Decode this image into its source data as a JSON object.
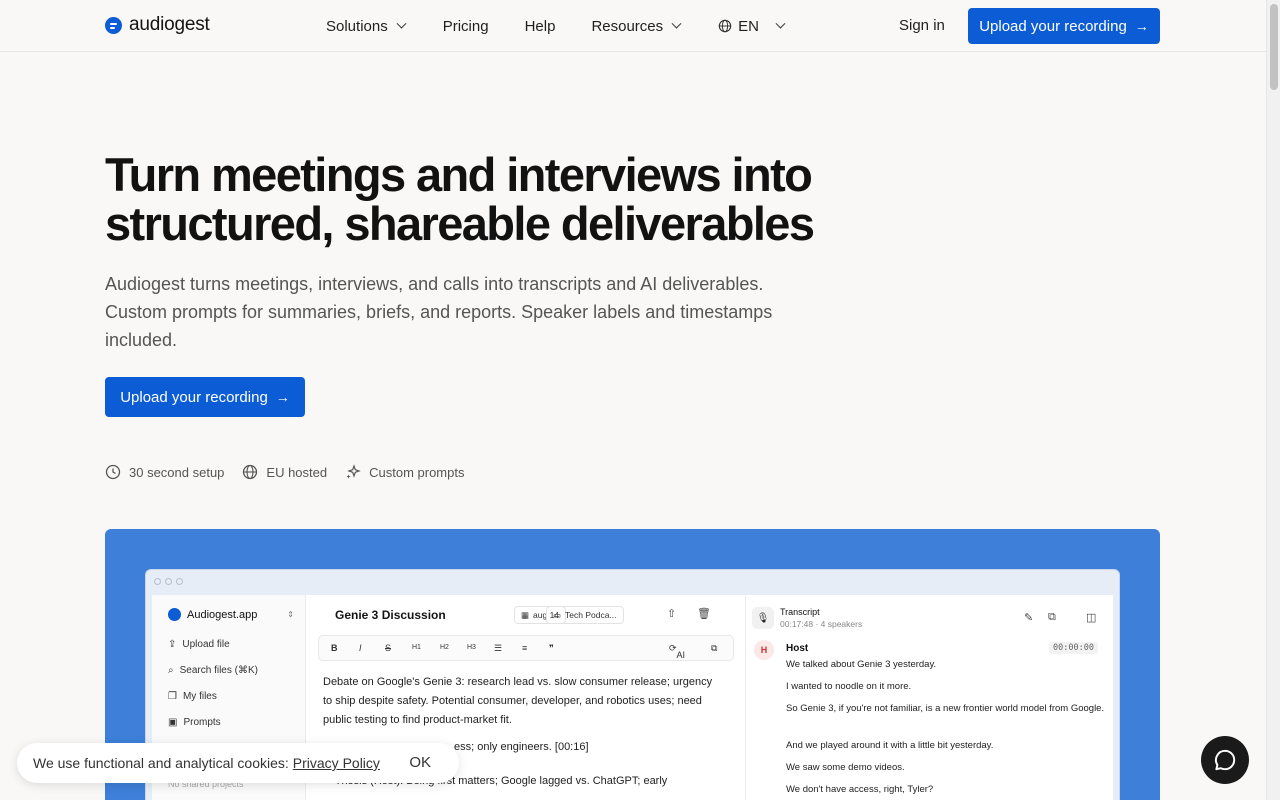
{
  "brand": {
    "name": "audiogest",
    "color": "#0b5cd5"
  },
  "nav": {
    "items": [
      {
        "label": "Solutions",
        "dropdown": true
      },
      {
        "label": "Pricing",
        "dropdown": false
      },
      {
        "label": "Help",
        "dropdown": false
      },
      {
        "label": "Resources",
        "dropdown": true
      }
    ],
    "language": "EN",
    "sign_in": "Sign in",
    "cta": "Upload your recording"
  },
  "hero": {
    "title_line1": "Turn meetings and interviews into",
    "title_line2": "structured, shareable deliverables",
    "subtitle": "Audiogest turns meetings, interviews, and calls into transcripts and AI deliverables. Custom prompts for summaries, briefs, and reports. Speaker labels and timestamps included.",
    "cta": "Upload your recording",
    "features": [
      "30 second setup",
      "EU hosted",
      "Custom prompts"
    ]
  },
  "preview": {
    "sidebar": {
      "workspace": "Audiogest.app",
      "items": [
        "Upload file",
        "Search files (⌘K)",
        "My files",
        "Prompts"
      ],
      "muted": "No shared projects"
    },
    "editor": {
      "title": "Genie 3 Discussion",
      "date_chip": "aug 14",
      "folder_chip": "Tech Podca...",
      "toolbar": [
        "B",
        "I",
        "S",
        "H1",
        "H2",
        "H3",
        "AI"
      ],
      "summary": "Debate on Google's Genie 3: research lead vs. slow consumer release; urgency to ship despite safety. Potential consumer, developer, and robotics uses; need public testing to find product-market fit.",
      "line2": "ess; only engineers. [00:16]",
      "bullet": "Thesis (Host): Being first matters; Google lagged vs. ChatGPT; early"
    },
    "transcript": {
      "title": "Transcript",
      "meta": "00:17:48 · 4 speakers",
      "speaker_initial": "H",
      "speaker": "Host",
      "timestamp": "00:00:00",
      "lines": [
        "We talked about Genie 3 yesterday.",
        "I wanted to noodle on it more.",
        "So Genie 3, if you're not familiar, is a new frontier world model from Google.",
        "And we played around it with a little bit yesterday.",
        "We saw some demo videos.",
        "We don't have access, right, Tyler?"
      ]
    }
  },
  "cookie": {
    "text": "We use functional and analytical cookies:",
    "policy": "Privacy Policy",
    "ok": "OK"
  }
}
